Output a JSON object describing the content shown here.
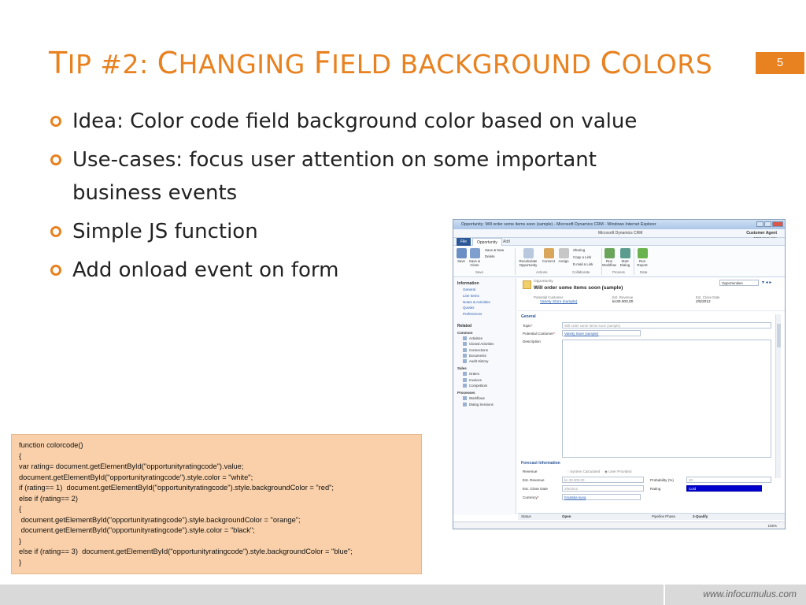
{
  "slide": {
    "title_parts": [
      {
        "t": "T",
        "big": true
      },
      {
        "t": "IP #2: ",
        "big": false
      },
      {
        "t": "C",
        "big": true
      },
      {
        "t": "HANGING ",
        "big": false
      },
      {
        "t": "F",
        "big": true
      },
      {
        "t": "IELD BACKGROUND ",
        "big": false
      },
      {
        "t": "C",
        "big": true
      },
      {
        "t": "OLORS",
        "big": false
      }
    ],
    "page_number": "5",
    "bullets": [
      "Idea: Color code field background color based on value",
      "Use-cases: focus user attention on some important business events",
      "Simple JS function",
      "Add onload event on form"
    ],
    "code_lines": [
      "function colorcode()",
      "{",
      "var rating= document.getElementById(\"opportunityratingcode\").value;",
      "document.getElementById(\"opportunityratingcode\").style.color = \"white\";",
      "if (rating== 1)  document.getElementById(\"opportunityratingcode\").style.backgroundColor = \"red\";",
      "else if (rating== 2)",
      "{",
      " document.getElementById(\"opportunityratingcode\").style.backgroundColor = \"orange\";",
      " document.getElementById(\"opportunityratingcode\").style.color = \"black\";",
      "}",
      "else if (rating== 3)  document.getElementById(\"opportunityratingcode\").style.backgroundColor = \"blue\";",
      "}"
    ],
    "footer_url": "www.infocumulus.com",
    "accent_color": "#e8811f"
  },
  "crm": {
    "window_title": "Opportunity: Will order some items soon (sample) - Microsoft Dynamics CRM - Windows Internet Explorer",
    "brand": "Microsoft Dynamics CRM",
    "user": "Customer Agent",
    "org": "MSCommunity",
    "tabs": [
      "File",
      "Opportunity",
      "Add"
    ],
    "ribbon": {
      "save": "Save",
      "save_close": "Save & Close",
      "save_new": "Save & New",
      "delete": "Delete",
      "recalculate": "Recalculate Opportunity",
      "connect": "Connect",
      "assign": "Assign",
      "sharing": "Sharing",
      "copy_link": "Copy a Link",
      "email_link": "E-mail a Link",
      "run_workflow": "Run Workflow",
      "start_dialog": "Start Dialog",
      "run_report": "Run Report",
      "groups": [
        "Save",
        "Actions",
        "Collaborate",
        "Process",
        "Data"
      ]
    },
    "nav": {
      "information": "Information",
      "info_links": [
        "General",
        "Line Items",
        "Notes & Activities",
        "Quotes",
        "Preferences"
      ],
      "related": "Related",
      "common": "Common",
      "common_items": [
        "Activities",
        "Closed Activities",
        "Connections",
        "Documents",
        "Audit History"
      ],
      "sales": "Sales",
      "sales_items": [
        "Orders",
        "Invoices",
        "Competitors"
      ],
      "processes": "Processes",
      "process_items": [
        "Workflows",
        "Dialog Sessions"
      ]
    },
    "header": {
      "entity": "Opportunity",
      "title": "Will order some items soon (sample)",
      "potential_customer_label": "Potential Customer",
      "potential_customer": "Variety Store (sample)",
      "est_revenue_label": "Est. Revenue",
      "est_revenue": "kn30.000,00",
      "est_close_label": "Est. Close Date",
      "est_close": "2/5/2012",
      "form_select": "Opportunities"
    },
    "general": {
      "section": "General",
      "topic_label": "Topic",
      "topic_value": "Will order some items soon (sample)",
      "customer_label": "Potential Customer",
      "customer_value": "Variety Store (sample)",
      "description_label": "Description"
    },
    "forecast": {
      "section": "Forecast Information",
      "revenue_label": "Revenue",
      "system_calc": "System Calculated",
      "user_provided": "User Provided",
      "est_revenue_label": "Est. Revenue",
      "est_revenue_value": "kn 30.000,00",
      "probability_label": "Probability (%)",
      "probability_value": "20",
      "close_label": "Est. Close Date",
      "close_value": "2/5/2012",
      "rating_label": "Rating",
      "rating_value": "Cold",
      "currency_label": "Currency",
      "currency_value": "hrvatska kuna"
    },
    "status": {
      "status_label": "Status",
      "status_value": "Open",
      "phase_label": "Pipeline Phase",
      "phase_value": "2-Qualify"
    },
    "zoom": "105%"
  }
}
